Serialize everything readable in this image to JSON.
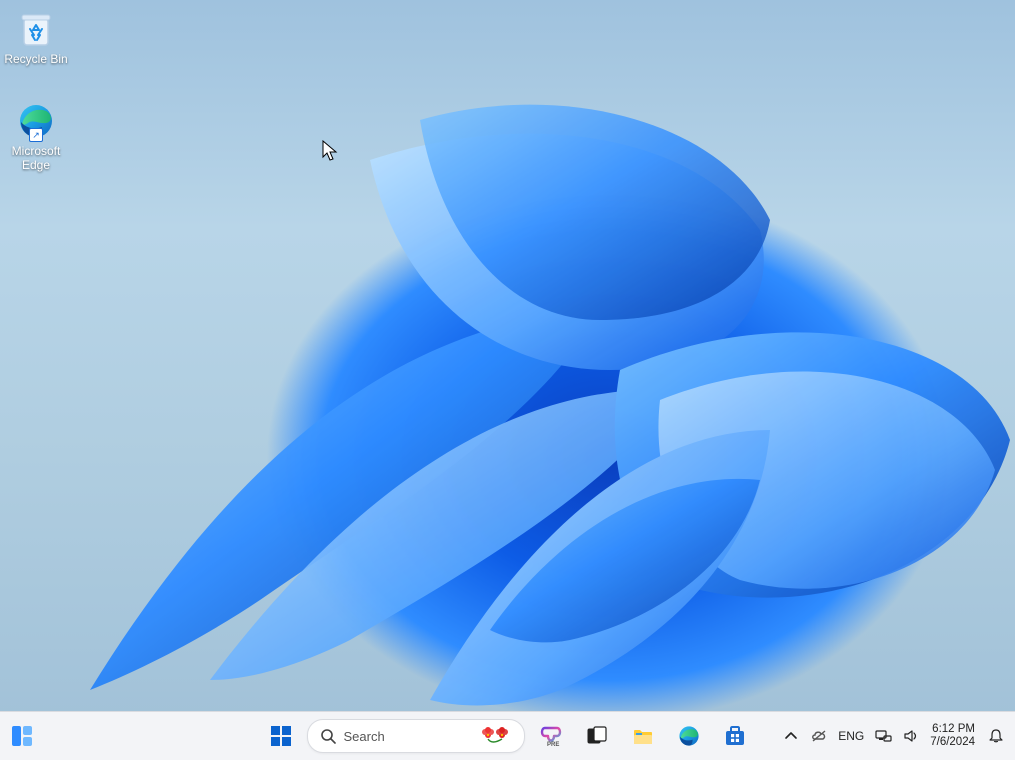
{
  "desktop_icons": [
    {
      "label": "Recycle Bin"
    },
    {
      "label": "Microsoft Edge"
    }
  ],
  "taskbar": {
    "search_label": "Search",
    "language": "ENG"
  },
  "clock": {
    "time": "6:12 PM",
    "date": "7/6/2024"
  }
}
